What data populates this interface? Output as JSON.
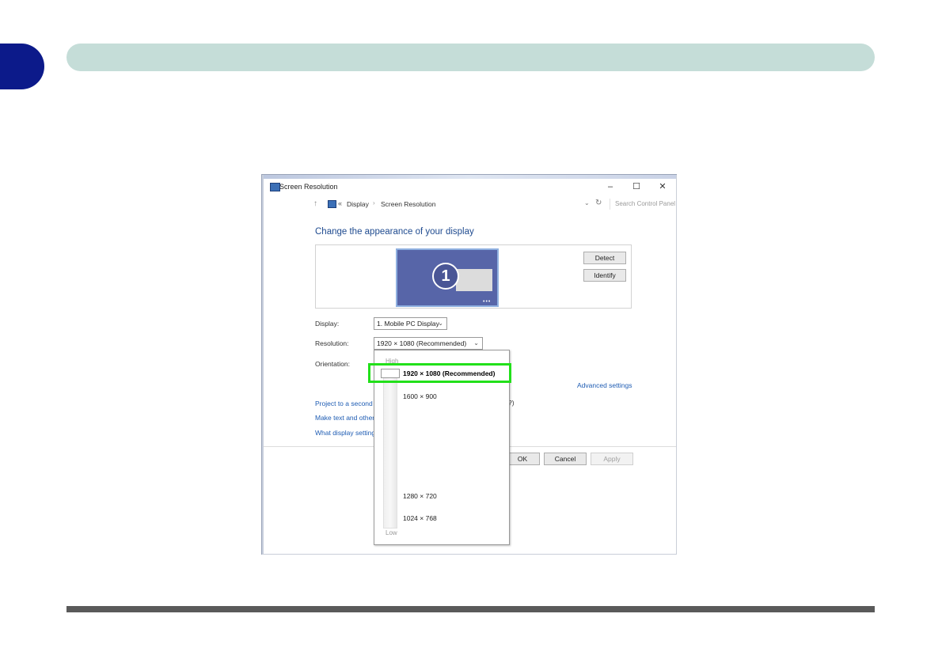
{
  "window": {
    "title": "Screen Resolution"
  },
  "address_bar": {
    "chevrons": "«",
    "breadcrumbs": [
      "Display",
      "Screen Resolution"
    ],
    "search_placeholder": "Search Control Panel"
  },
  "heading": "Change the appearance of your display",
  "buttons": {
    "detect": "Detect",
    "identify": "Identify",
    "ok": "OK",
    "cancel": "Cancel",
    "apply": "Apply"
  },
  "monitor_number": "1",
  "form": {
    "display_label": "Display:",
    "display_value": "1. Mobile PC Display",
    "resolution_label": "Resolution:",
    "resolution_value": "1920 × 1080 (Recommended)",
    "orientation_label": "Orientation:"
  },
  "links": {
    "advanced": "Advanced settings",
    "project": "Project to a second",
    "text_size": "Make text and other",
    "what_settings": "What display setting"
  },
  "paren_fragment": "?)",
  "resolution_dropdown": {
    "high_label": "High",
    "low_label": "Low",
    "options": [
      "1920 × 1080 (Recommended)",
      "1600 × 900",
      "1280 × 720",
      "1024 × 768"
    ],
    "selected": "1920 × 1080 (Recommended)"
  },
  "colors": {
    "page_tab": "#0c1a8a",
    "header_bar": "#c5ddd8",
    "highlight": "#22e01a",
    "link": "#1e5cb3",
    "heading": "#1e4a8f"
  }
}
